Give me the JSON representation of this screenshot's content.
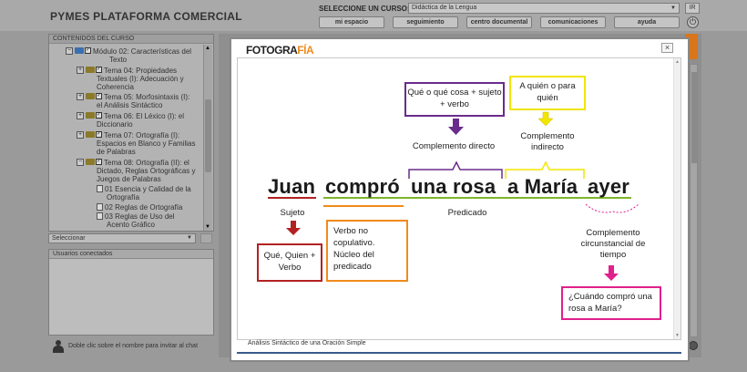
{
  "app": {
    "title": "PYMES PLATAFORMA COMERCIAL",
    "course_label": "SELECCIONE UN CURSO:",
    "course_value": "Didáctica de la Lengua",
    "ir_label": "IR",
    "nav": [
      "mi espacio",
      "seguimiento",
      "centro documental",
      "comunicaciones",
      "ayuda"
    ]
  },
  "sidebar": {
    "header": "CONTENIDOS DEL CURSO",
    "items": [
      "Módulo 02: Características del",
      "Texto",
      "Tema 04: Propiedades",
      "Textuales (I): Adecuación y",
      "Coherencia",
      "Tema 05: Morfosintaxis (I):",
      "el Análisis Sintáctico",
      "Tema 06: El Léxico (I): el",
      "Diccionario",
      "Tema 07: Ortografía (I):",
      "Espacios en Blanco y Familias",
      "de Palabras",
      "Tema 08: Ortografía (II): el",
      "Dictado, Reglas Ortográficas y",
      "Juegos de Palabras",
      "01 Esencia y Calidad de la",
      "Ortografía",
      "02 Reglas de Ortografía",
      "03 Reglas de Uso del",
      "Acento Gráfico"
    ],
    "select_placeholder": "Seleccionar",
    "users_header": "Usuarios conectados",
    "chat_hint": "Doble clic sobre el nombre para invitar al chat"
  },
  "modal": {
    "logo_main": "FOTOGRA",
    "logo_accent": "FÍA",
    "close": "×",
    "caption": "Análisis Sintáctico de una Oración Simple"
  },
  "diagram": {
    "sentence": {
      "juan": "Juan",
      "compro": "compró",
      "una_rosa": "una rosa",
      "a_maria": "a María",
      "ayer": "ayer"
    },
    "box_cd": "Qué o qué cosa + sujeto + verbo",
    "box_ci": "A quién o para quién",
    "label_cd": "Complemento directo",
    "label_ci": "Complemento indirecto",
    "label_sujeto": "Sujeto",
    "label_predicado": "Predicado",
    "box_sujeto": "Qué, Quien + Verbo",
    "box_verbo": "Verbo no copulativo. Núcleo del predicado",
    "label_cct": "Complemento circunstancial de tiempo",
    "box_cct": "¿Cuándo compró una rosa a María?",
    "colors": {
      "cd": "#6a2b8c",
      "ci": "#f2e500",
      "sujeto": "#b22222",
      "verbo": "#f08a1c",
      "predicado": "#7fb52a",
      "cct": "#e0208c"
    }
  }
}
